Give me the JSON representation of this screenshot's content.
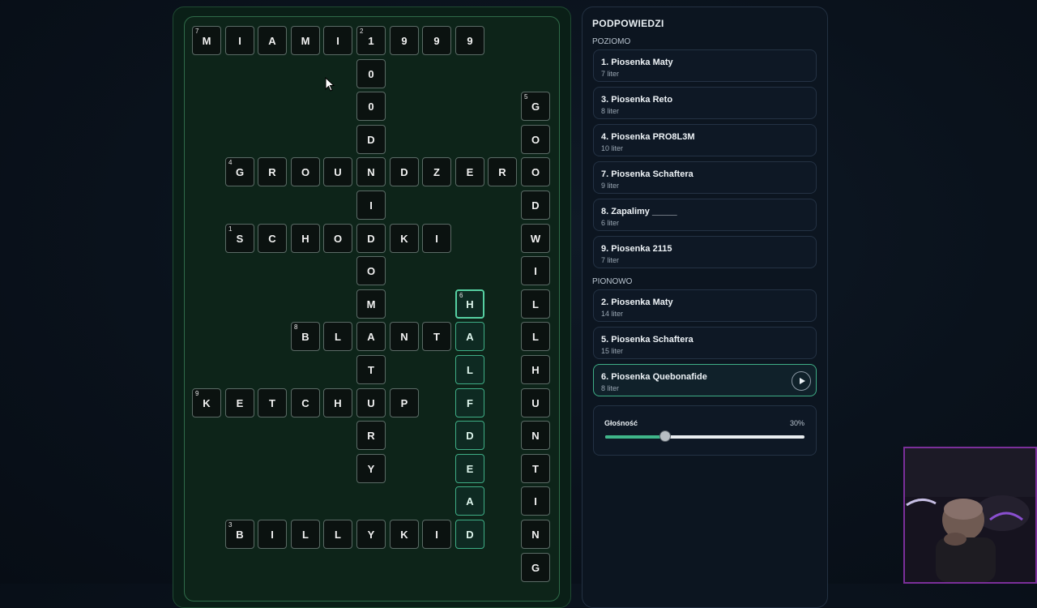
{
  "panel": {
    "title": "PODPOWIEDZI",
    "across_label": "POZIOMO",
    "down_label": "PIONOWO",
    "across": [
      {
        "title": "1. Piosenka Maty",
        "sub": "7 liter"
      },
      {
        "title": "3. Piosenka Reto",
        "sub": "8 liter"
      },
      {
        "title": "4. Piosenka PRO8L3M",
        "sub": "10 liter"
      },
      {
        "title": "7. Piosenka Schaftera",
        "sub": "9 liter"
      },
      {
        "title": "8. Zapalimy _____",
        "sub": "6 liter"
      },
      {
        "title": "9. Piosenka 2115",
        "sub": "7 liter"
      }
    ],
    "down": [
      {
        "title": "2. Piosenka Maty",
        "sub": "14 liter"
      },
      {
        "title": "5. Piosenka Schaftera",
        "sub": "15 liter"
      },
      {
        "title": "6. Piosenka Quebonafide",
        "sub": "8 liter"
      }
    ]
  },
  "volume": {
    "label": "Głośność",
    "percent_label": "30%",
    "value": 0.3
  },
  "colors": {
    "accent": "#3fae86",
    "slider_fill": "#3fb68a",
    "webcam_border": "#7b2f9a"
  },
  "grid": {
    "cells": [
      {
        "r": 0,
        "c": 0,
        "ch": "M",
        "num": "7"
      },
      {
        "r": 0,
        "c": 1,
        "ch": "I"
      },
      {
        "r": 0,
        "c": 2,
        "ch": "A"
      },
      {
        "r": 0,
        "c": 3,
        "ch": "M"
      },
      {
        "r": 0,
        "c": 4,
        "ch": "I"
      },
      {
        "r": 0,
        "c": 5,
        "ch": "1",
        "num": "2"
      },
      {
        "r": 0,
        "c": 6,
        "ch": "9"
      },
      {
        "r": 0,
        "c": 7,
        "ch": "9"
      },
      {
        "r": 0,
        "c": 8,
        "ch": "9"
      },
      {
        "r": 1,
        "c": 5,
        "ch": "0"
      },
      {
        "r": 2,
        "c": 5,
        "ch": "0"
      },
      {
        "r": 2,
        "c": 10,
        "ch": "G",
        "num": "5"
      },
      {
        "r": 3,
        "c": 5,
        "ch": "D"
      },
      {
        "r": 3,
        "c": 10,
        "ch": "O"
      },
      {
        "r": 4,
        "c": 1,
        "ch": "G",
        "num": "4"
      },
      {
        "r": 4,
        "c": 2,
        "ch": "R"
      },
      {
        "r": 4,
        "c": 3,
        "ch": "O"
      },
      {
        "r": 4,
        "c": 4,
        "ch": "U"
      },
      {
        "r": 4,
        "c": 5,
        "ch": "N"
      },
      {
        "r": 4,
        "c": 6,
        "ch": "D"
      },
      {
        "r": 4,
        "c": 7,
        "ch": "Z"
      },
      {
        "r": 4,
        "c": 8,
        "ch": "E"
      },
      {
        "r": 4,
        "c": 9,
        "ch": "R"
      },
      {
        "r": 4,
        "c": 10,
        "ch": "O"
      },
      {
        "r": 5,
        "c": 5,
        "ch": "I"
      },
      {
        "r": 5,
        "c": 10,
        "ch": "D"
      },
      {
        "r": 6,
        "c": 1,
        "ch": "S",
        "num": "1"
      },
      {
        "r": 6,
        "c": 2,
        "ch": "C"
      },
      {
        "r": 6,
        "c": 3,
        "ch": "H"
      },
      {
        "r": 6,
        "c": 4,
        "ch": "O"
      },
      {
        "r": 6,
        "c": 5,
        "ch": "D"
      },
      {
        "r": 6,
        "c": 6,
        "ch": "K"
      },
      {
        "r": 6,
        "c": 7,
        "ch": "I"
      },
      {
        "r": 6,
        "c": 10,
        "ch": "W"
      },
      {
        "r": 7,
        "c": 5,
        "ch": "O"
      },
      {
        "r": 7,
        "c": 10,
        "ch": "I"
      },
      {
        "r": 8,
        "c": 5,
        "ch": "M"
      },
      {
        "r": 8,
        "c": 8,
        "ch": "H",
        "num": "6",
        "hl": true,
        "active": true
      },
      {
        "r": 8,
        "c": 10,
        "ch": "L"
      },
      {
        "r": 9,
        "c": 3,
        "ch": "B",
        "num": "8"
      },
      {
        "r": 9,
        "c": 4,
        "ch": "L"
      },
      {
        "r": 9,
        "c": 5,
        "ch": "A"
      },
      {
        "r": 9,
        "c": 6,
        "ch": "N"
      },
      {
        "r": 9,
        "c": 7,
        "ch": "T"
      },
      {
        "r": 9,
        "c": 8,
        "ch": "A",
        "hl": true
      },
      {
        "r": 9,
        "c": 10,
        "ch": "L"
      },
      {
        "r": 10,
        "c": 5,
        "ch": "T"
      },
      {
        "r": 10,
        "c": 8,
        "ch": "L",
        "hl": true
      },
      {
        "r": 10,
        "c": 10,
        "ch": "H"
      },
      {
        "r": 11,
        "c": 0,
        "ch": "K",
        "num": "9"
      },
      {
        "r": 11,
        "c": 1,
        "ch": "E"
      },
      {
        "r": 11,
        "c": 2,
        "ch": "T"
      },
      {
        "r": 11,
        "c": 3,
        "ch": "C"
      },
      {
        "r": 11,
        "c": 4,
        "ch": "H"
      },
      {
        "r": 11,
        "c": 5,
        "ch": "U"
      },
      {
        "r": 11,
        "c": 6,
        "ch": "P"
      },
      {
        "r": 11,
        "c": 8,
        "ch": "F",
        "hl": true
      },
      {
        "r": 11,
        "c": 10,
        "ch": "U"
      },
      {
        "r": 12,
        "c": 5,
        "ch": "R"
      },
      {
        "r": 12,
        "c": 8,
        "ch": "D",
        "hl": true
      },
      {
        "r": 12,
        "c": 10,
        "ch": "N"
      },
      {
        "r": 13,
        "c": 5,
        "ch": "Y"
      },
      {
        "r": 13,
        "c": 8,
        "ch": "E",
        "hl": true
      },
      {
        "r": 13,
        "c": 10,
        "ch": "T"
      },
      {
        "r": 14,
        "c": 8,
        "ch": "A",
        "hl": true
      },
      {
        "r": 14,
        "c": 10,
        "ch": "I"
      },
      {
        "r": 15,
        "c": 1,
        "ch": "B",
        "num": "3"
      },
      {
        "r": 15,
        "c": 2,
        "ch": "I"
      },
      {
        "r": 15,
        "c": 3,
        "ch": "L"
      },
      {
        "r": 15,
        "c": 4,
        "ch": "L"
      },
      {
        "r": 15,
        "c": 5,
        "ch": "Y"
      },
      {
        "r": 15,
        "c": 6,
        "ch": "K"
      },
      {
        "r": 15,
        "c": 7,
        "ch": "I"
      },
      {
        "r": 15,
        "c": 8,
        "ch": "D",
        "hl": true
      },
      {
        "r": 15,
        "c": 10,
        "ch": "N"
      },
      {
        "r": 16,
        "c": 10,
        "ch": "G"
      }
    ]
  }
}
